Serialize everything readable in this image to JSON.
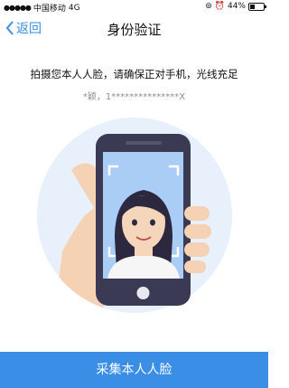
{
  "status_bar": {
    "carrier": "中国移动",
    "network": "4G",
    "battery": "44%"
  },
  "nav": {
    "back_label": "返回",
    "title": "身份验证"
  },
  "instruction": "拍摄您本人人脸，请确保正对手机，光线充足",
  "masked_identity": "*颖，1***************X",
  "primary_button": "采集本人人脸",
  "colors": {
    "accent": "#3a8ee6",
    "circle_bg": "#e7f0fb",
    "phone_body": "#3b3a55"
  },
  "icons": [
    "signal-dots-icon",
    "alarm-icon",
    "location-icon",
    "battery-icon",
    "back-chevron-icon"
  ]
}
